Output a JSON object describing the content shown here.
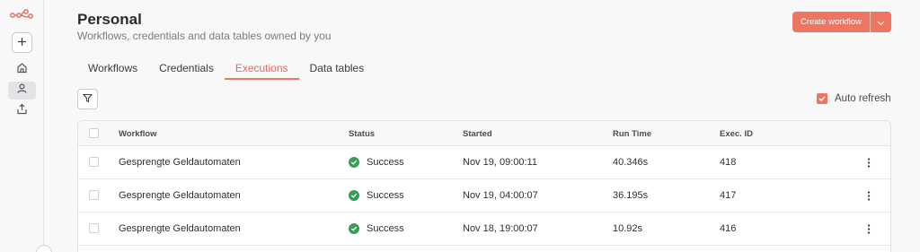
{
  "header": {
    "title": "Personal",
    "subtitle": "Workflows, credentials and data tables owned by you",
    "create_label": "Create workflow"
  },
  "tabs": [
    {
      "label": "Workflows",
      "active": false
    },
    {
      "label": "Credentials",
      "active": false
    },
    {
      "label": "Executions",
      "active": true
    },
    {
      "label": "Data tables",
      "active": false
    }
  ],
  "toolbar": {
    "auto_refresh_label": "Auto refresh",
    "auto_refresh_checked": true
  },
  "table": {
    "columns": {
      "workflow": "Workflow",
      "status": "Status",
      "started": "Started",
      "run_time": "Run Time",
      "exec_id": "Exec. ID"
    },
    "rows": [
      {
        "workflow": "Gesprengte Geldautomaten",
        "status": "Success",
        "started": "Nov 19, 09:00:11",
        "run_time": "40.346s",
        "exec_id": "418"
      },
      {
        "workflow": "Gesprengte Geldautomaten",
        "status": "Success",
        "started": "Nov 19, 04:00:07",
        "run_time": "36.195s",
        "exec_id": "417"
      },
      {
        "workflow": "Gesprengte Geldautomaten",
        "status": "Success",
        "started": "Nov 18, 19:00:07",
        "run_time": "10.92s",
        "exec_id": "416"
      }
    ]
  },
  "colors": {
    "accent": "#ee7561",
    "success": "#3c9b5a"
  },
  "icons": {
    "sidebar": [
      "logo-icon",
      "plus-icon",
      "home-icon",
      "user-icon",
      "share-icon"
    ],
    "filter": "filter-icon",
    "row_actions": "kebab-icon"
  }
}
